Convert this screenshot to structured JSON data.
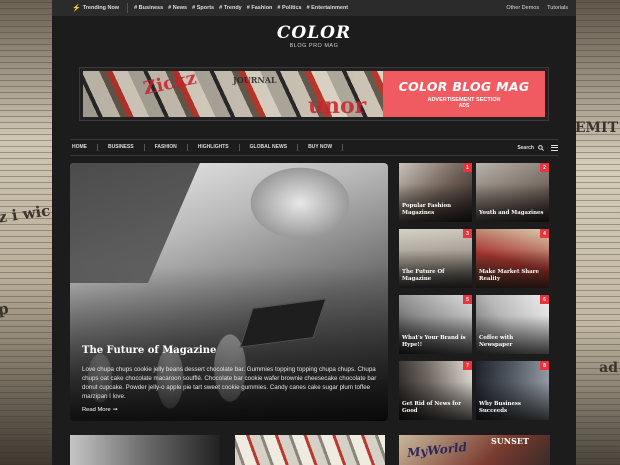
{
  "background": {
    "left_words": [
      "z i wic",
      "p"
    ],
    "right_words": [
      "EMIT",
      "ad"
    ]
  },
  "topbar": {
    "trending_label": "Trending Now",
    "tags": [
      "# Business",
      "# News",
      "# Sports",
      "# Trendy",
      "# Fashion",
      "# Politics",
      "# Entertainment"
    ],
    "links": [
      "Other Demos",
      "Tutorials"
    ]
  },
  "logo": {
    "title": "COLOR",
    "tagline": "BLOG PRO MAG"
  },
  "ad": {
    "photo_words": [
      "Zickz",
      "JOURNAL",
      "unor"
    ],
    "title": "COLOR BLOG MAG",
    "line1": "ADVERTISEMENT SECTION",
    "line2": "ADS"
  },
  "nav": {
    "items": [
      "HOME",
      "BUSINESS",
      "FASHION",
      "HIGHLIGHTS",
      "GLOBAL NEWS",
      "BUY NOW"
    ],
    "search_label": "Search"
  },
  "hero": {
    "title": "The Future of Magazine",
    "excerpt": "Love chupa chups cookie jelly beans dessert chocolate bar. Gummies topping topping chupa chups. Chupa chups oat cake chocolate macaroon soufflé. Chocolate bar cookie wafer brownie cheesecake chocolate bar donut cupcake. Powder jelly-o apple pie tart sweet cookie gummies. Candy canes cake sugar plum toffee marzipan I love.",
    "read_more": "Read More"
  },
  "cards": [
    {
      "num": "1",
      "title": "Popular Fashion Magazines",
      "colors": [
        "#c9c2b8",
        "#6b5b53",
        "#2d2523"
      ]
    },
    {
      "num": "2",
      "title": "Youth and Magazines",
      "colors": [
        "#b8b2a8",
        "#7a6e66",
        "#3a302c"
      ]
    },
    {
      "num": "3",
      "title": "The Future Of Magazine",
      "colors": [
        "#d6d0c6",
        "#9c958a",
        "#4b4640"
      ]
    },
    {
      "num": "4",
      "title": "Make Market Share Reality",
      "colors": [
        "#d9cdb0",
        "#a8352f",
        "#5a4738"
      ]
    },
    {
      "num": "5",
      "title": "What's Your Brand is Hype!!",
      "colors": [
        "#dcdcdc",
        "#8a8a8a",
        "#2e2e2e"
      ]
    },
    {
      "num": "6",
      "title": "Coffee with Newspaper",
      "colors": [
        "#efefef",
        "#b7b7b7",
        "#5f5f5f"
      ]
    },
    {
      "num": "7",
      "title": "Get Rid of News for Good",
      "colors": [
        "#e2ddd5",
        "#6d6660",
        "#1e1b19"
      ]
    },
    {
      "num": "8",
      "title": "Why Business Succeeds",
      "colors": [
        "#9aa0a8",
        "#4f5660",
        "#1f2329"
      ]
    }
  ],
  "bottom": {
    "words": [
      "MyWorld",
      "SUNSET"
    ]
  }
}
